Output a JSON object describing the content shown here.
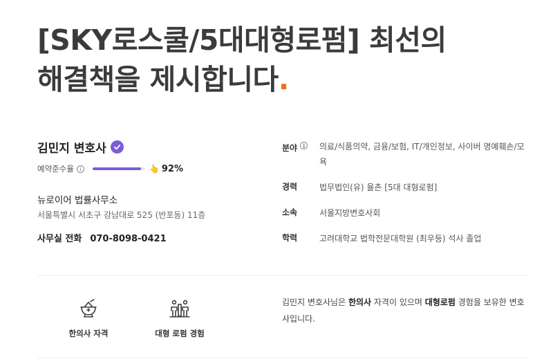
{
  "headline": {
    "line1": "[SKY로스쿨/5대대형로펌] 최선의",
    "line2": "해결책을 제시합니다",
    "dot": "."
  },
  "lawyer": {
    "name": "김민지 변호사",
    "verified_icon": "verified-badge-icon"
  },
  "reservation": {
    "label": "예약준수율",
    "value_text": "92%",
    "value": 0.92,
    "hand_icon": "pointing-hand-emoji",
    "bar_color": "#7b5bd6"
  },
  "office": {
    "name": "뉴로이어 법률사무소",
    "address": "서울특별시 서초구 강남대로 525 (반포동) 11층",
    "phone_label": "사무실 전화",
    "phone": "070-8098-0421"
  },
  "info": {
    "field": {
      "key": "분야",
      "value": "의료/식품의약, 금융/보험, IT/개인정보, 사이버 명예훼손/모욕"
    },
    "career": {
      "key": "경력",
      "value": "법무법인(유) 율촌 [5대 대형로펌]"
    },
    "affiliation": {
      "key": "소속",
      "value": "서울지방변호사회"
    },
    "education": {
      "key": "학력",
      "value": "고려대학교 법학전문대학원 (최우등) 석사 졸업"
    }
  },
  "badges": [
    {
      "label": "한의사 자격",
      "icon": "herbal-medicine-bowl-icon"
    },
    {
      "label": "대형 로펌 경험",
      "icon": "law-firm-team-icon"
    }
  ],
  "summary": {
    "p1": "김민지 변호사님은 ",
    "b1": "한의사",
    "p2": " 자격이 있으며 ",
    "b2": "대형로펌",
    "p3": " 경험을 보유한 변호사입니다."
  },
  "colors": {
    "accent": "#7b5bd6",
    "dot": "#f26d21",
    "headline": "#3b3b3b"
  }
}
